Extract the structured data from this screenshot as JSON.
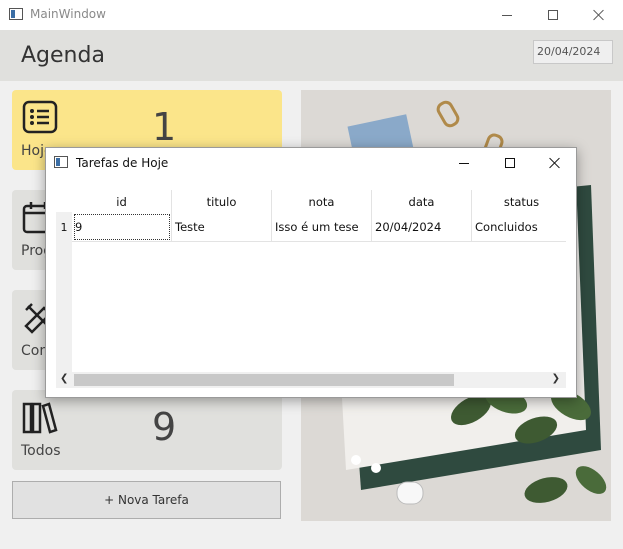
{
  "window": {
    "title": "MainWindow"
  },
  "header": {
    "title": "Agenda",
    "date": "20/04/2024"
  },
  "cards": [
    {
      "label": "Hoje",
      "count": "1",
      "icon": "list-icon"
    },
    {
      "label": "Programadas",
      "count": "",
      "icon": "calendar-icon"
    },
    {
      "label": "Concluídas",
      "count": "",
      "icon": "pencil-ruler-icon"
    },
    {
      "label": "Todos",
      "count": "9",
      "icon": "books-icon"
    }
  ],
  "new_task_button": "+ Nova Tarefa",
  "dialog": {
    "title": "Tarefas de Hoje",
    "columns": [
      "id",
      "titulo",
      "nota",
      "data",
      "status"
    ],
    "rows": [
      {
        "row_number": "1",
        "cells": [
          "9",
          "Teste",
          "Isso é um tese",
          "20/04/2024",
          "Concluidos"
        ]
      }
    ]
  },
  "colors": {
    "today_card": "#fbe58a",
    "card": "#e0e0dd",
    "header": "#e0e0dd"
  }
}
